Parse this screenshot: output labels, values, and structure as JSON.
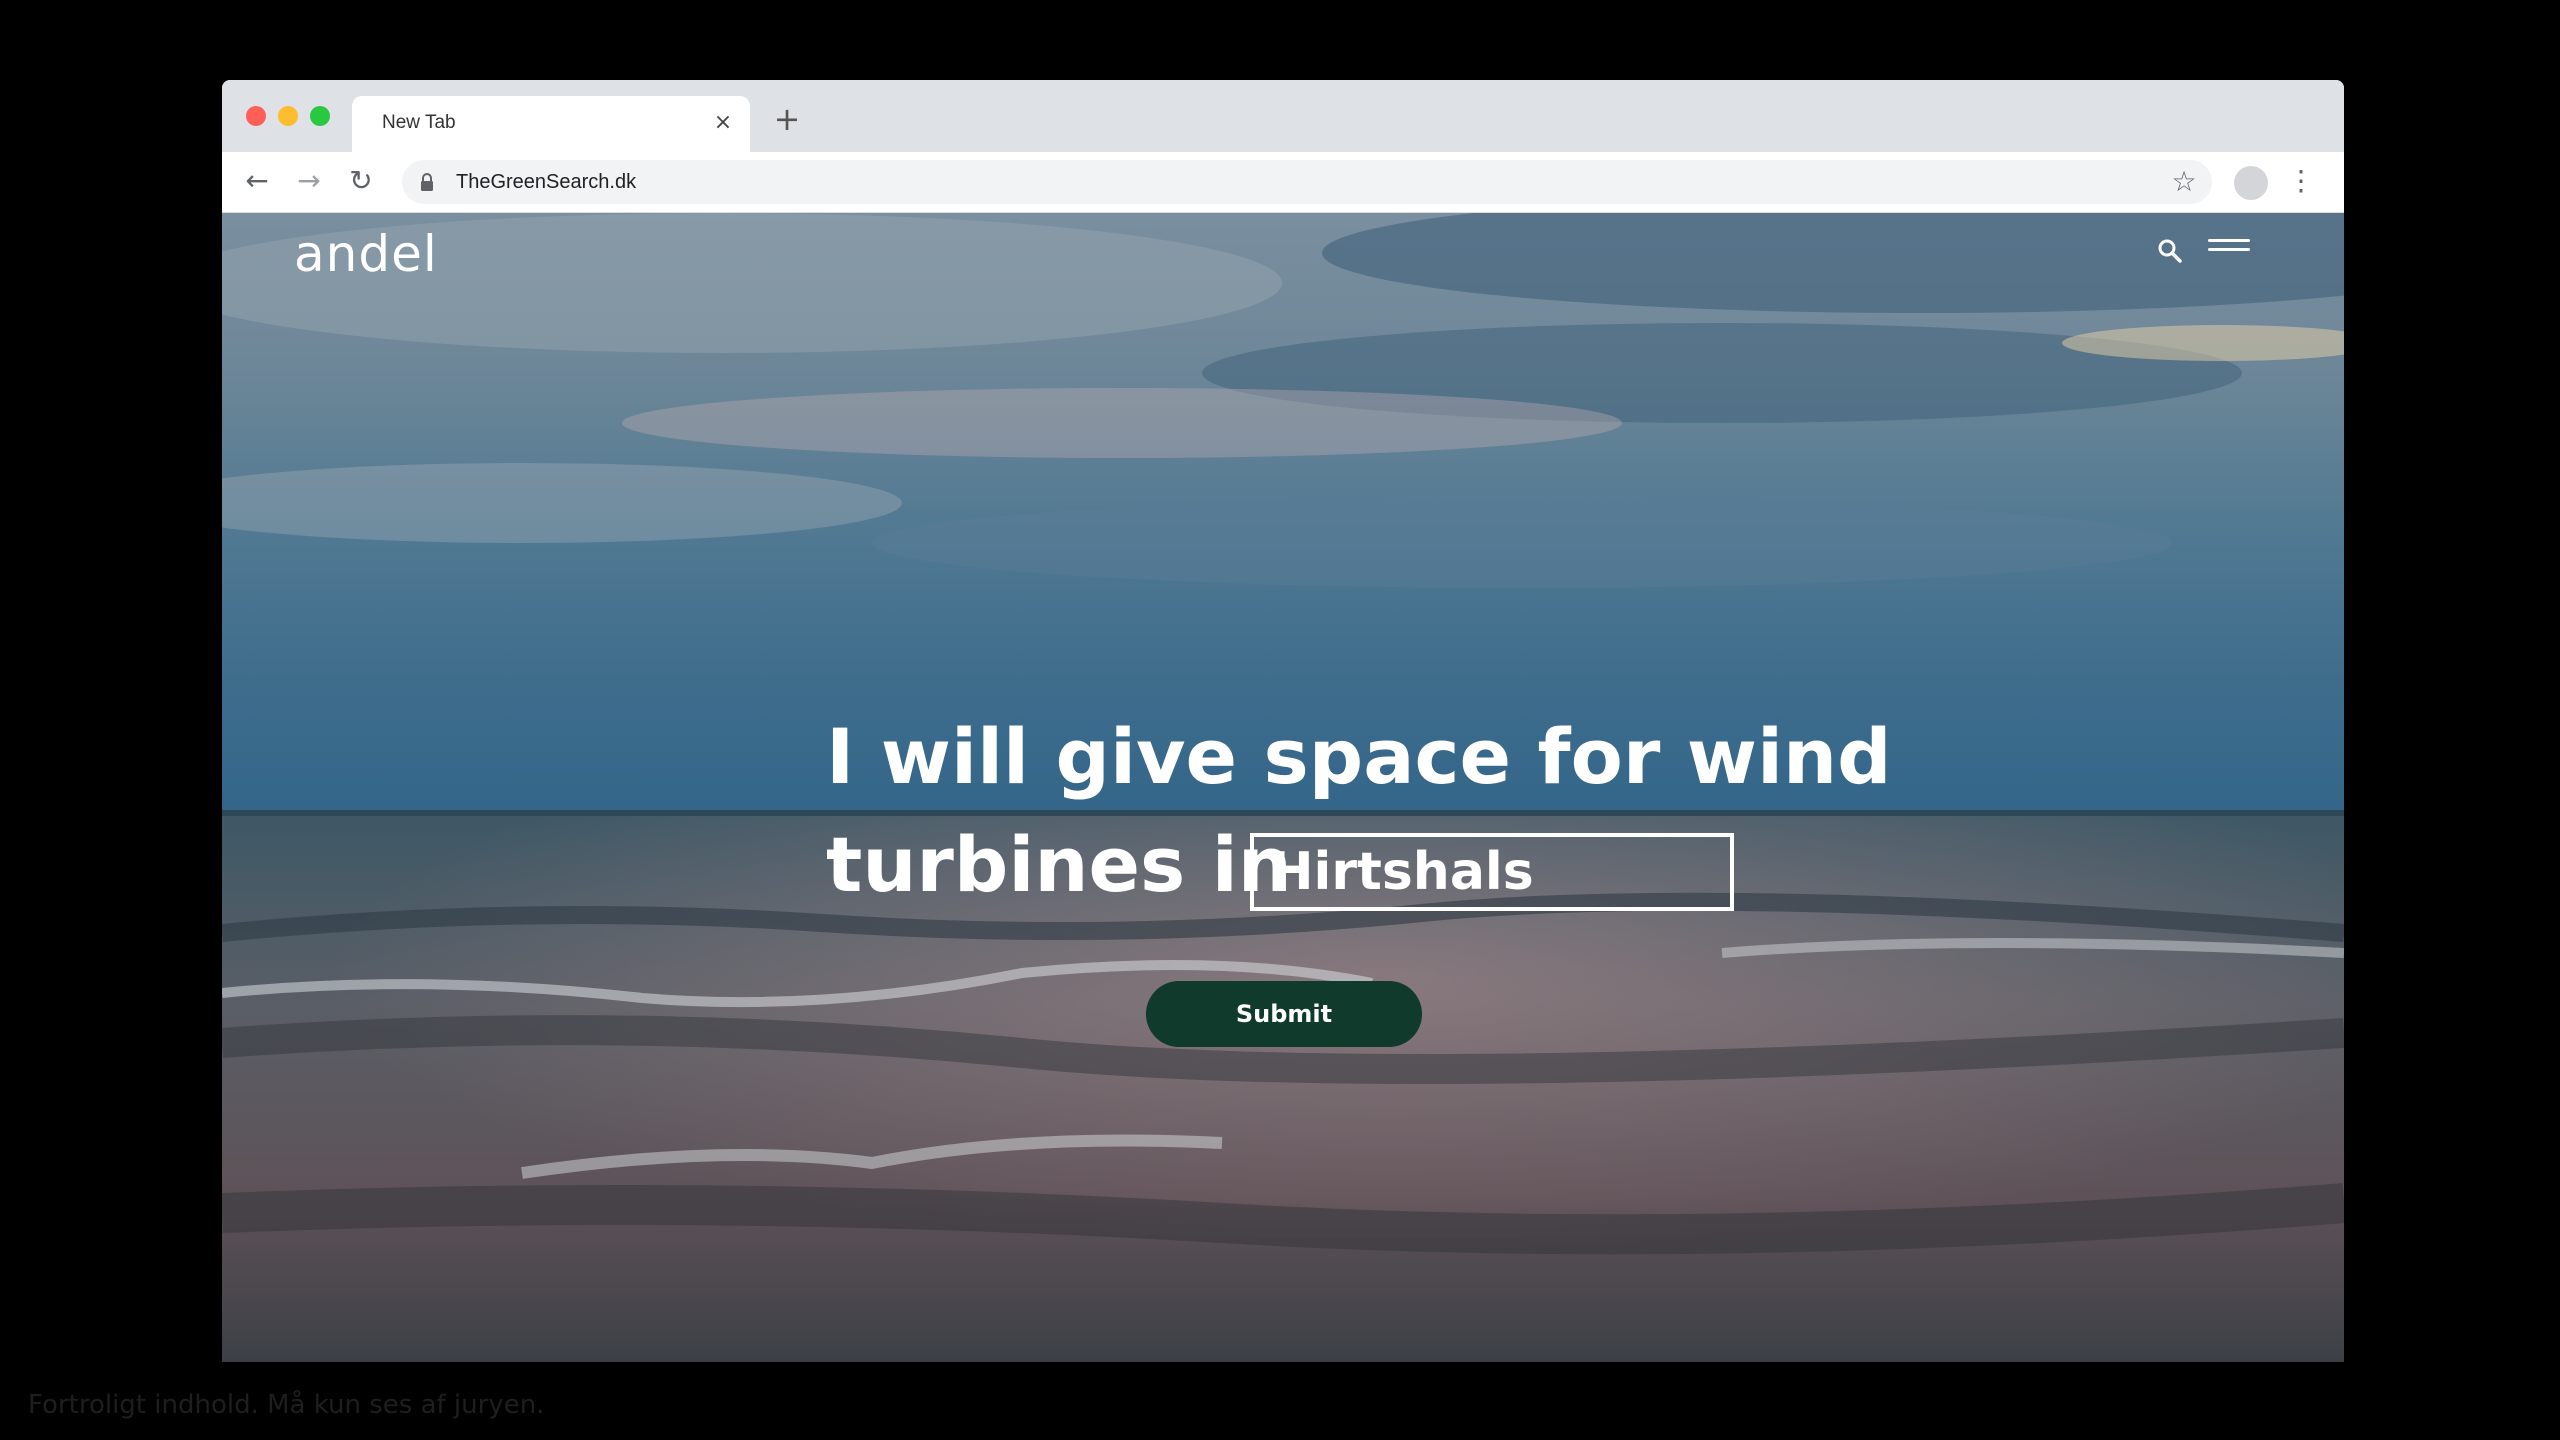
{
  "browser": {
    "tab": {
      "title": "New Tab",
      "close_glyph": "×"
    },
    "new_tab_glyph": "+",
    "toolbar": {
      "back_glyph": "←",
      "forward_glyph": "→",
      "reload_glyph": "↻",
      "url": "TheGreenSearch.dk",
      "star_glyph": "☆",
      "menu_glyph": "⋮"
    },
    "traffic_colors": {
      "close": "#ff5f57",
      "minimize": "#febc2e",
      "maximize": "#28c840"
    }
  },
  "site": {
    "logo": "andel",
    "headline_line1": "I will give space for wind",
    "headline_line2": "turbines in",
    "location_value": "Hirtshals",
    "submit_label": "Submit",
    "accent_color": "#0f3a2c"
  },
  "footer_note": "Fortroligt indhold. Må kun ses af juryen."
}
